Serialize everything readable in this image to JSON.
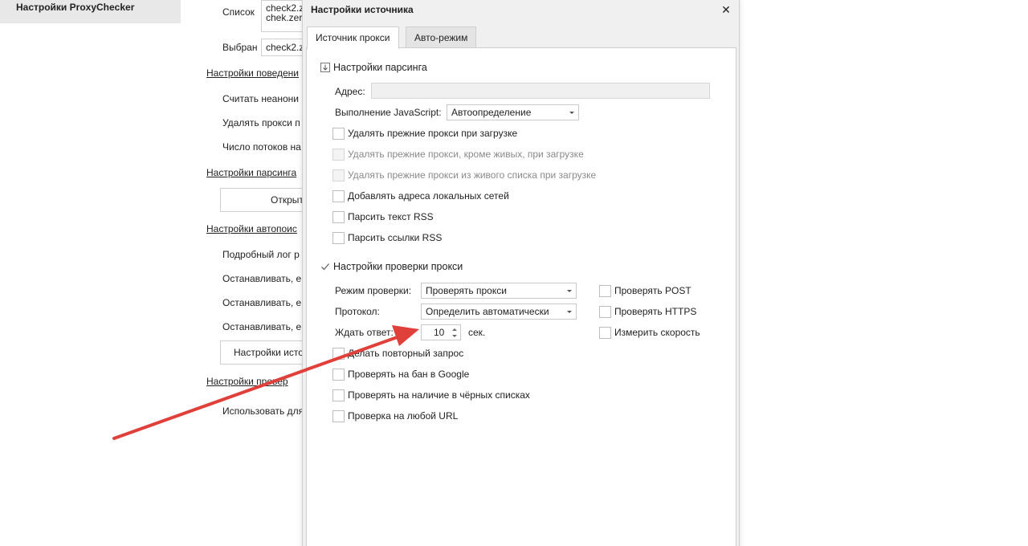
{
  "background_window": {
    "nav_item": "Настройки ProxyChecker",
    "list_label": "Список",
    "list_lines": [
      "check2.z",
      "chek.zer"
    ],
    "selected_label": "Выбран",
    "selected_value": "check2.z",
    "link_behavior": "Настройки поведени",
    "row_count_anon": "Считать неанони",
    "row_delete_proxy": "Удалять прокси п",
    "row_threads": "Число потоков на",
    "link_parsing": "Настройки парсинга",
    "btn_open": "Открыт",
    "link_autosearch": "Настройки автопоис",
    "row_verbose_log": "Подробный лог р",
    "row_stop_1": "Останавливать, е",
    "row_stop_2": "Останавливать, е",
    "row_stop_3": "Останавливать, е",
    "btn_source_settings": "Настройки исто",
    "link_check": "Настройки провер",
    "row_use_for": "Использовать для"
  },
  "dialog": {
    "title": "Настройки источника",
    "close_glyph": "✕",
    "tabs": [
      {
        "label": "Источник прокси",
        "active": true
      },
      {
        "label": "Авто-режим",
        "active": false
      }
    ],
    "parsing_group": {
      "title": "Настройки парсинга",
      "icon": "collapse-box-icon",
      "address_label": "Адрес:",
      "address_value": "",
      "js_label": "Выполнение JavaScript:",
      "js_value": "Автоопределение",
      "checkboxes": [
        {
          "label": "Удалять прежние прокси при загрузке",
          "checked": false,
          "disabled": false
        },
        {
          "label": "Удалять прежние прокси, кроме живых, при загрузке",
          "checked": false,
          "disabled": true
        },
        {
          "label": "Удалять прежние прокси из живого списка при загрузке",
          "checked": false,
          "disabled": true
        },
        {
          "label": "Добавлять адреса локальных сетей",
          "checked": false,
          "disabled": false
        },
        {
          "label": "Парсить текст RSS",
          "checked": false,
          "disabled": false
        },
        {
          "label": "Парсить ссылки RSS",
          "checked": false,
          "disabled": false
        }
      ]
    },
    "check_group": {
      "title": "Настройки проверки прокси",
      "icon": "checkmark-icon",
      "mode_label": "Режим проверки:",
      "mode_value": "Проверять прокси",
      "protocol_label": "Протокол:",
      "protocol_value": "Определить автоматически",
      "timeout_label": "Ждать ответ:",
      "timeout_value": "10",
      "timeout_unit": "сек.",
      "right_checkboxes": [
        {
          "label": "Проверять POST",
          "checked": false
        },
        {
          "label": "Проверять HTTPS",
          "checked": false
        },
        {
          "label": "Измерить скорость",
          "checked": false
        }
      ],
      "checkboxes": [
        {
          "label": "Делать повторный запрос",
          "checked": false
        },
        {
          "label": "Проверять на бан в Google",
          "checked": false
        },
        {
          "label": "Проверять на наличие в чёрных списках",
          "checked": false
        },
        {
          "label": "Проверка на любой URL",
          "checked": false
        }
      ]
    }
  },
  "annotation": {
    "arrow_color": "#e0403a"
  }
}
